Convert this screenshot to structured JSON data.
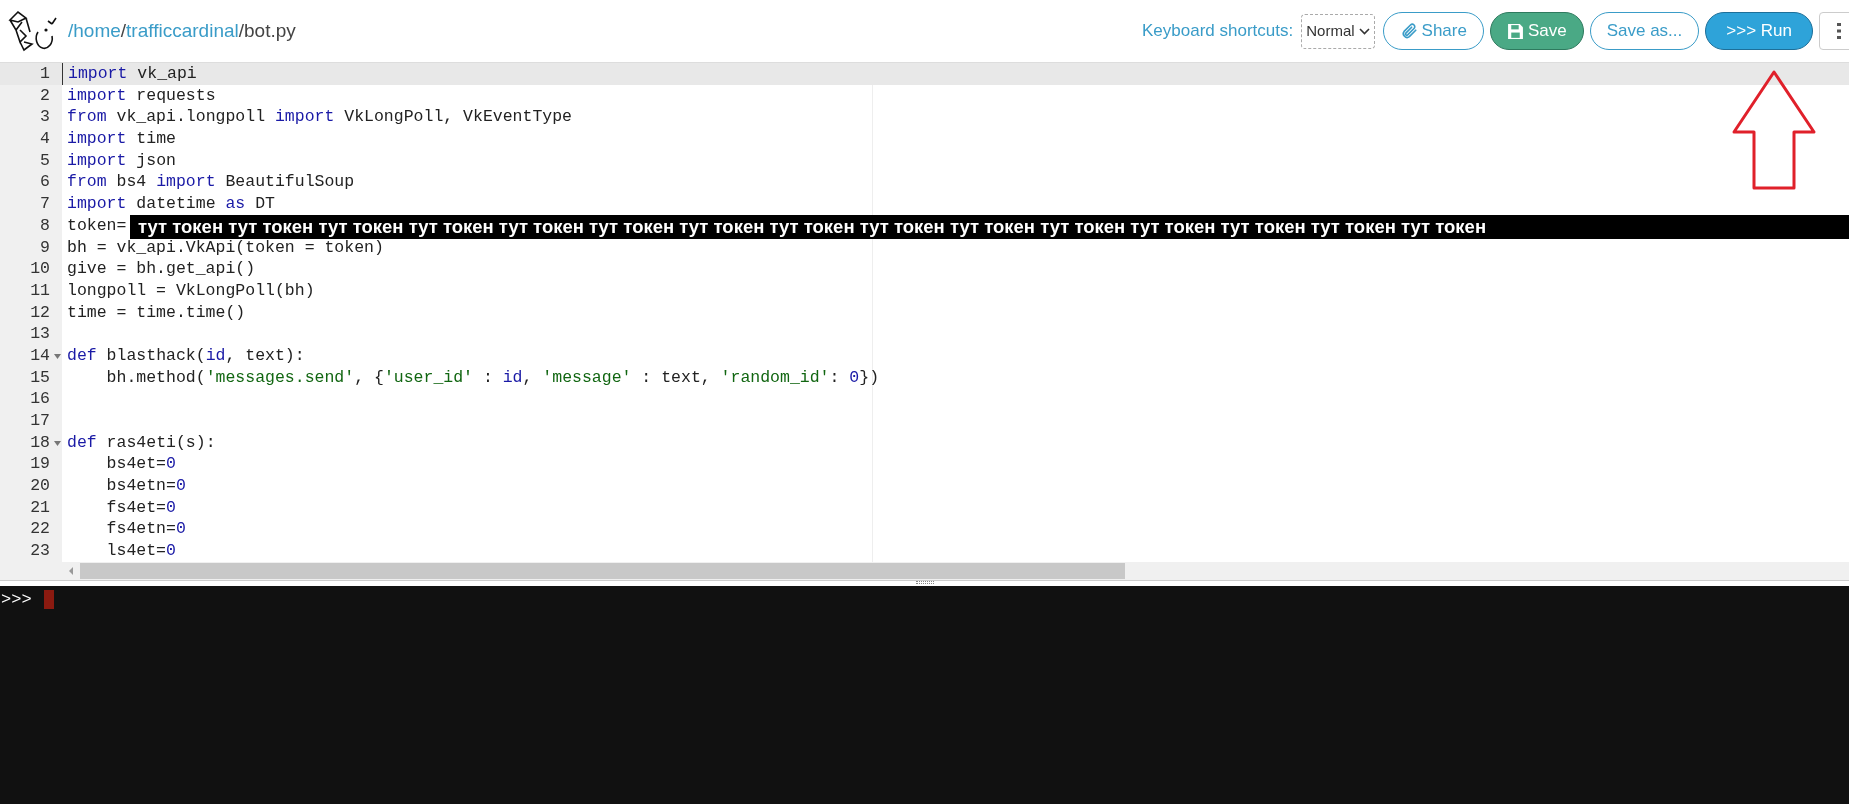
{
  "header": {
    "path": [
      {
        "kind": "link",
        "text": "/home"
      },
      {
        "kind": "text",
        "text": "/"
      },
      {
        "kind": "link",
        "text": "trafficcardinal"
      },
      {
        "kind": "text",
        "text": "/bot.py"
      }
    ],
    "shortcuts_label": "Keyboard shortcuts:",
    "shortcuts_select": {
      "value": "Normal"
    },
    "buttons": [
      {
        "kind": "share",
        "label": "Share"
      },
      {
        "kind": "save",
        "label": "Save"
      },
      {
        "kind": "outline",
        "label": "Save as..."
      },
      {
        "kind": "run",
        "label": ">>> Run"
      },
      {
        "kind": "menu"
      }
    ]
  },
  "editor": {
    "lines": [
      {
        "number": "1",
        "current": true,
        "foldable": false,
        "tokens": [
          {
            "kind": "keyword",
            "text": "import"
          },
          {
            "kind": "plain",
            "text": " vk_api"
          }
        ]
      },
      {
        "number": "2",
        "current": false,
        "foldable": false,
        "tokens": [
          {
            "kind": "keyword",
            "text": "import"
          },
          {
            "kind": "plain",
            "text": " requests"
          }
        ]
      },
      {
        "number": "3",
        "current": false,
        "foldable": false,
        "tokens": [
          {
            "kind": "keyword",
            "text": "from"
          },
          {
            "kind": "plain",
            "text": " vk_api.longpoll "
          },
          {
            "kind": "keyword",
            "text": "import"
          },
          {
            "kind": "plain",
            "text": " VkLongPoll, VkEventType"
          }
        ]
      },
      {
        "number": "4",
        "current": false,
        "foldable": false,
        "tokens": [
          {
            "kind": "keyword",
            "text": "import"
          },
          {
            "kind": "plain",
            "text": " time"
          }
        ]
      },
      {
        "number": "5",
        "current": false,
        "foldable": false,
        "tokens": [
          {
            "kind": "keyword",
            "text": "import"
          },
          {
            "kind": "plain",
            "text": " json"
          }
        ]
      },
      {
        "number": "6",
        "current": false,
        "foldable": false,
        "tokens": [
          {
            "kind": "keyword",
            "text": "from"
          },
          {
            "kind": "plain",
            "text": " bs4 "
          },
          {
            "kind": "keyword",
            "text": "import"
          },
          {
            "kind": "plain",
            "text": " BeautifulSoup"
          }
        ]
      },
      {
        "number": "7",
        "current": false,
        "foldable": false,
        "tokens": [
          {
            "kind": "keyword",
            "text": "import"
          },
          {
            "kind": "plain",
            "text": " datetime "
          },
          {
            "kind": "keyword",
            "text": "as"
          },
          {
            "kind": "plain",
            "text": " DT"
          }
        ]
      },
      {
        "number": "8",
        "current": false,
        "foldable": false,
        "tokens": [
          {
            "kind": "plain",
            "text": "token="
          }
        ]
      },
      {
        "number": "9",
        "current": false,
        "foldable": false,
        "tokens": [
          {
            "kind": "plain",
            "text": "bh = vk_api.VkApi(token = token)"
          }
        ]
      },
      {
        "number": "10",
        "current": false,
        "foldable": false,
        "tokens": [
          {
            "kind": "plain",
            "text": "give = bh.get_api()"
          }
        ]
      },
      {
        "number": "11",
        "current": false,
        "foldable": false,
        "tokens": [
          {
            "kind": "plain",
            "text": "longpoll = VkLongPoll(bh)"
          }
        ]
      },
      {
        "number": "12",
        "current": false,
        "foldable": false,
        "tokens": [
          {
            "kind": "plain",
            "text": "time = time.time()"
          }
        ]
      },
      {
        "number": "13",
        "current": false,
        "foldable": false
      },
      {
        "number": "14",
        "current": false,
        "foldable": true,
        "tokens": [
          {
            "kind": "keyword",
            "text": "def"
          },
          {
            "kind": "plain",
            "text": " blasthack("
          },
          {
            "kind": "param",
            "text": "id"
          },
          {
            "kind": "plain",
            "text": ", text):"
          }
        ]
      },
      {
        "number": "15",
        "current": false,
        "foldable": false,
        "tokens": [
          {
            "kind": "plain",
            "text": "    bh.method("
          },
          {
            "kind": "string",
            "text": "'messages.send'"
          },
          {
            "kind": "plain",
            "text": ", {"
          },
          {
            "kind": "string",
            "text": "'user_id'"
          },
          {
            "kind": "plain",
            "text": " : "
          },
          {
            "kind": "param",
            "text": "id"
          },
          {
            "kind": "plain",
            "text": ", "
          },
          {
            "kind": "string",
            "text": "'message'"
          },
          {
            "kind": "plain",
            "text": " : text, "
          },
          {
            "kind": "string",
            "text": "'random_id'"
          },
          {
            "kind": "plain",
            "text": ": "
          },
          {
            "kind": "number",
            "text": "0"
          },
          {
            "kind": "plain",
            "text": "})"
          }
        ]
      },
      {
        "number": "16",
        "current": false,
        "foldable": false
      },
      {
        "number": "17",
        "current": false,
        "foldable": false
      },
      {
        "number": "18",
        "current": false,
        "foldable": true,
        "tokens": [
          {
            "kind": "keyword",
            "text": "def"
          },
          {
            "kind": "plain",
            "text": " ras4eti(s):"
          }
        ]
      },
      {
        "number": "19",
        "current": false,
        "foldable": false,
        "tokens": [
          {
            "kind": "plain",
            "text": "    bs4et="
          },
          {
            "kind": "number",
            "text": "0"
          }
        ]
      },
      {
        "number": "20",
        "current": false,
        "foldable": false,
        "tokens": [
          {
            "kind": "plain",
            "text": "    bs4etn="
          },
          {
            "kind": "number",
            "text": "0"
          }
        ]
      },
      {
        "number": "21",
        "current": false,
        "foldable": false,
        "tokens": [
          {
            "kind": "plain",
            "text": "    fs4et="
          },
          {
            "kind": "number",
            "text": "0"
          }
        ]
      },
      {
        "number": "22",
        "current": false,
        "foldable": false,
        "tokens": [
          {
            "kind": "plain",
            "text": "    fs4etn="
          },
          {
            "kind": "number",
            "text": "0"
          }
        ]
      },
      {
        "number": "23",
        "current": false,
        "foldable": false,
        "tokens": [
          {
            "kind": "plain",
            "text": "    ls4et="
          },
          {
            "kind": "number",
            "text": "0"
          }
        ]
      }
    ],
    "redaction": "тут токен тут токен тут токен тут токен тут токен тут токен тут токен тут токен тут токен тут токен тут токен тут токен тут токен тут токен тут токен"
  },
  "console": {
    "prompt": ">>>"
  }
}
